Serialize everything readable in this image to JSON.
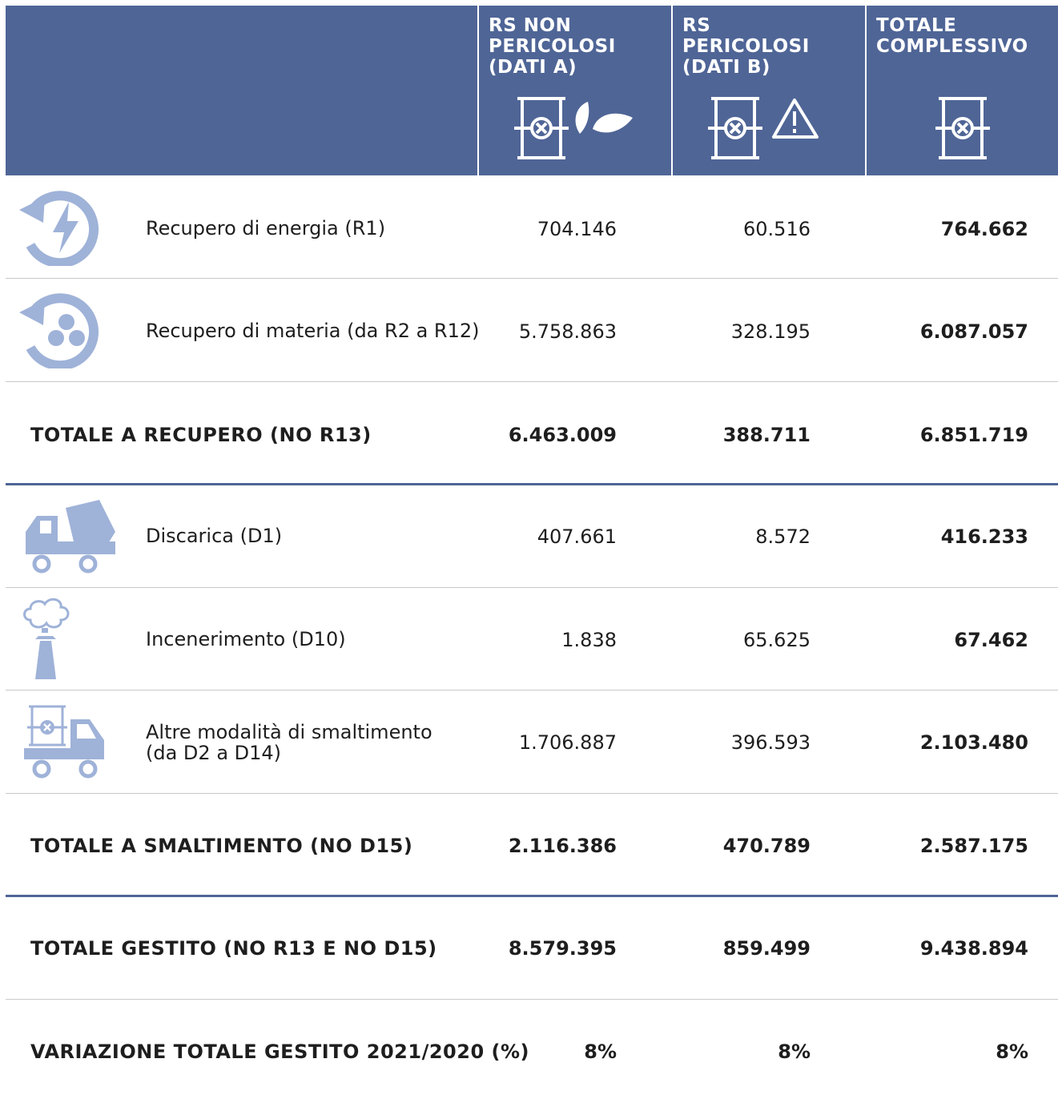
{
  "colors": {
    "header_bg": "#4f6596",
    "icon": "#9fb2d8",
    "rule": "#c9c9c9"
  },
  "header": {
    "columns": [
      {
        "title": "RS NON\nPERICOLOSI\n(DATI A)",
        "icons": [
          "barrel-icon",
          "leaf-icon"
        ]
      },
      {
        "title": "RS\nPERICOLOSI\n(DATI B)",
        "icons": [
          "barrel-icon",
          "warning-icon"
        ]
      },
      {
        "title": "TOTALE\nCOMPLESSIVO",
        "icons": [
          "barrel-icon"
        ]
      }
    ]
  },
  "rows": {
    "r1": {
      "icon": "energy-recovery-icon",
      "label": "Recupero di energia (R1)",
      "v1": "704.146",
      "v2": "60.516",
      "v3": "764.662"
    },
    "r2": {
      "icon": "material-recovery-icon",
      "label": "Recupero di materia (da R2 a R12)",
      "v1": "5.758.863",
      "v2": "328.195",
      "v3": "6.087.057"
    },
    "t1": {
      "label": "TOTALE A RECUPERO (NO R13)",
      "v1": "6.463.009",
      "v2": "388.711",
      "v3": "6.851.719"
    },
    "d1": {
      "icon": "dump-truck-icon",
      "label": "Discarica (D1)",
      "v1": "407.661",
      "v2": "8.572",
      "v3": "416.233"
    },
    "d2": {
      "icon": "incinerator-icon",
      "label": "Incenerimento (D10)",
      "v1": "1.838",
      "v2": "65.625",
      "v3": "67.462"
    },
    "d3": {
      "icon": "barrel-truck-icon",
      "label_line1": "Altre modalità di smaltimento",
      "label_line2": "(da D2 a D14)",
      "v1": "1.706.887",
      "v2": "396.593",
      "v3": "2.103.480"
    },
    "t2": {
      "label": "TOTALE A SMALTIMENTO (NO D15)",
      "v1": "2.116.386",
      "v2": "470.789",
      "v3": "2.587.175"
    },
    "t3": {
      "label": "TOTALE GESTITO (NO R13 E NO D15)",
      "v1": "8.579.395",
      "v2": "859.499",
      "v3": "9.438.894"
    },
    "t4": {
      "label": "VARIAZIONE TOTALE GESTITO 2021/2020 (%)",
      "v1": "8%",
      "v2": "8%",
      "v3": "8%"
    }
  }
}
